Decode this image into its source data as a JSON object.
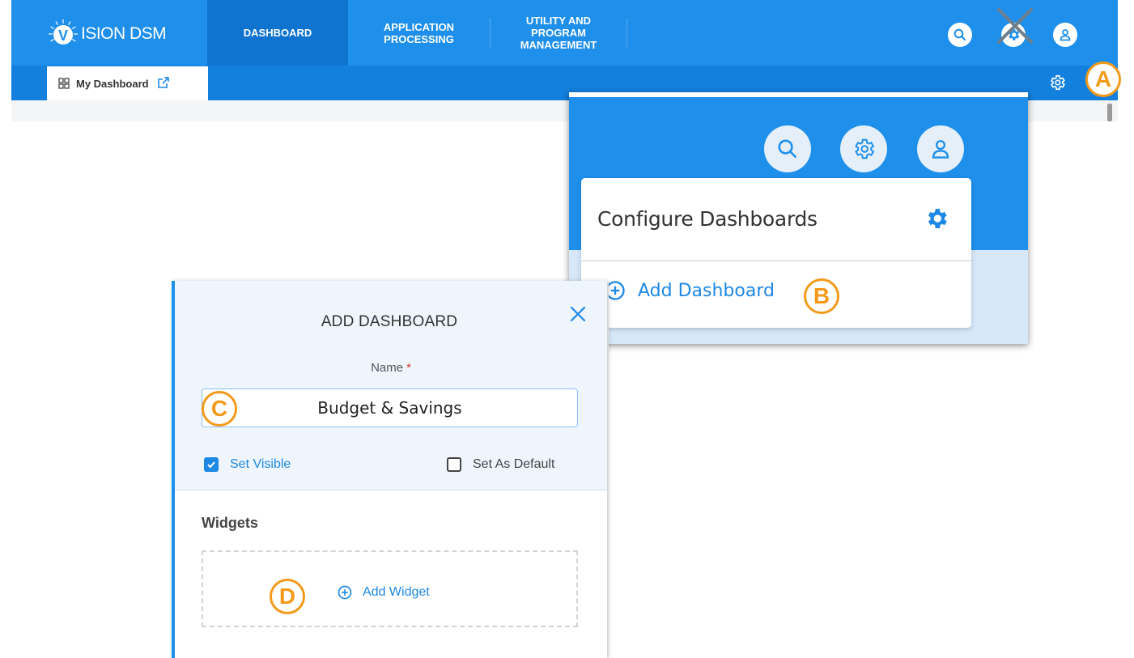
{
  "brand": {
    "logo_text": "ISION DSM",
    "logo_letter": "V"
  },
  "nav": {
    "items": [
      {
        "label": "DASHBOARD",
        "active": true
      },
      {
        "label": "APPLICATION\nPROCESSING",
        "active": false
      },
      {
        "label": "UTILITY AND\nPROGRAM\nMANAGEMENT",
        "active": false
      }
    ],
    "icons": [
      "search-icon",
      "gear-icon",
      "user-icon"
    ]
  },
  "subbar": {
    "tab_label": "My Dashboard",
    "tab_icon": "grid-icon",
    "external_icon": "external-link-icon"
  },
  "markers": {
    "a": "A",
    "b": "B",
    "c": "C",
    "d": "D"
  },
  "configure": {
    "title": "Configure Dashboards",
    "add_label": "Add Dashboard"
  },
  "modal": {
    "title": "ADD DASHBOARD",
    "name_label": "Name",
    "required_mark": "*",
    "name_value": "Budget & Savings",
    "set_visible_label": "Set Visible",
    "set_visible_checked": true,
    "set_default_label": "Set As Default",
    "set_default_checked": false,
    "widgets_heading": "Widgets",
    "add_widget_label": "Add Widget"
  },
  "colors": {
    "primary": "#1e8fea",
    "primary_dark": "#0f74d0",
    "link": "#1e88e5",
    "marker": "#f39a1a",
    "required": "#d9342b"
  }
}
